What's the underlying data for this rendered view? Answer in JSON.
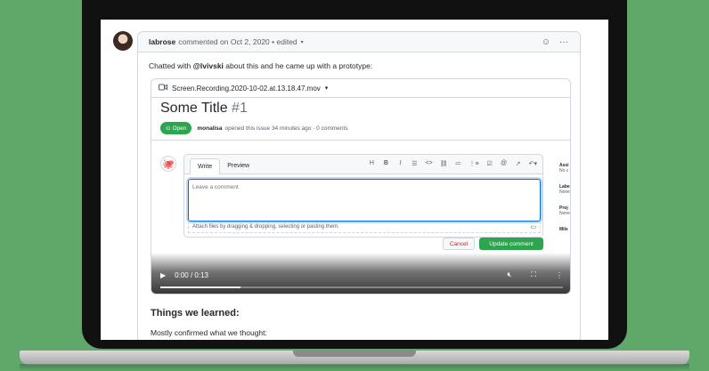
{
  "comment": {
    "author": "labrose",
    "meta": "commented on Oct 2, 2020",
    "edited": "• edited",
    "body_prefix": "Chatted with",
    "mention": "@lvivski",
    "body_suffix": "about this and he came up with a prototype:"
  },
  "video": {
    "filename": "Screen.Recording.2020-10-02.at.13.18.47.mov",
    "progress": 0.2
  },
  "issue": {
    "title": "Some Title",
    "number": "#1",
    "status": "Open",
    "user": "monalisa",
    "meta": "opened this issue 34 minutes ago · 0 comments"
  },
  "editor": {
    "tab_write": "Write",
    "tab_preview": "Preview",
    "placeholder": "Leave a comment",
    "attach_text": "Attach files by dragging & dropping, selecting or pasting them.",
    "cancel_label": "Cancel",
    "update_label": "Update comment"
  },
  "sidebar": {
    "assignees": "Assi",
    "assignees_val": "No c",
    "labels": "Labe",
    "labels_val": "None",
    "projects": "Proj",
    "projects_val": "None",
    "milestone": "Mile"
  },
  "player": {
    "time": "0:00 / 0:13"
  },
  "section": {
    "heading": "Things we learned:",
    "text": "Mostly confirmed what we thought:"
  },
  "colors": {
    "background": "#5fa86a",
    "open_green": "#2da44e",
    "focus_blue": "#0969da"
  }
}
